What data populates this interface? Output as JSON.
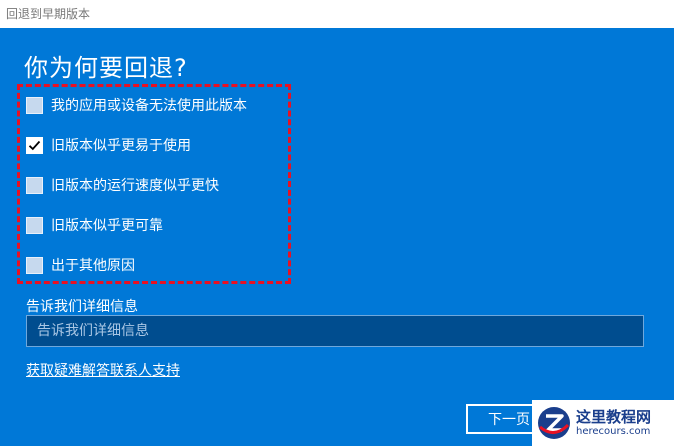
{
  "window": {
    "title": "回退到早期版本"
  },
  "main": {
    "heading": "你为何要回退?",
    "options": [
      {
        "label": "我的应用或设备无法使用此版本",
        "checked": false
      },
      {
        "label": "旧版本似乎更易于使用",
        "checked": true
      },
      {
        "label": "旧版本的运行速度似乎更快",
        "checked": false
      },
      {
        "label": "旧版本似乎更可靠",
        "checked": false
      },
      {
        "label": "出于其他原因",
        "checked": false
      }
    ],
    "details_label": "告诉我们详细信息",
    "details_placeholder": "告诉我们详细信息",
    "details_value": "",
    "help_link": "获取疑难解答联系人支持",
    "next_button": "下一页"
  },
  "watermark": {
    "title": "这里教程网",
    "url": "herecours.com"
  },
  "colors": {
    "background": "#0078d7",
    "highlight_border": "#e81123",
    "input_background": "#004d8f"
  }
}
